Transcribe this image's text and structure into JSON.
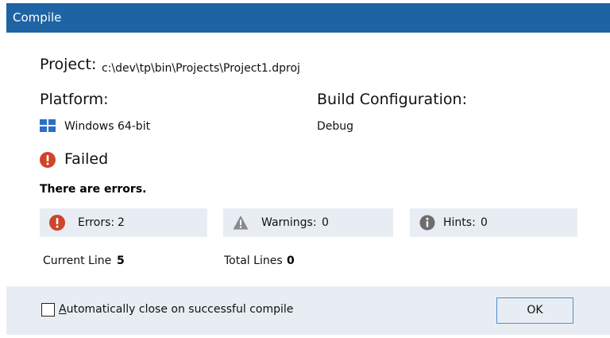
{
  "window": {
    "title": "Compile"
  },
  "project": {
    "label": "Project:",
    "path": "c:\\dev\\tp\\bin\\Projects\\Project1.dproj"
  },
  "platform": {
    "label": "Platform:",
    "value": "Windows 64-bit",
    "icon": "windows-logo-icon"
  },
  "build_configuration": {
    "label": "Build Configuration:",
    "value": "Debug"
  },
  "status": {
    "text": "Failed",
    "icon": "error-icon",
    "message": "There are errors."
  },
  "stats": {
    "errors": {
      "label": "Errors:",
      "value": "2",
      "icon": "error-icon"
    },
    "warnings": {
      "label": "Warnings:",
      "value": "0",
      "icon": "warning-icon"
    },
    "hints": {
      "label": "Hints:",
      "value": "0",
      "icon": "info-icon"
    }
  },
  "lines": {
    "current_label": "Current Line",
    "current_value": "5",
    "total_label": "Total Lines",
    "total_value": "0"
  },
  "footer": {
    "auto_close_mnemonic": "A",
    "auto_close_rest": "utomatically close on successful compile",
    "auto_close_checked": false,
    "ok_label": "OK"
  },
  "colors": {
    "title_bar": "#1e63a4",
    "panel_bg": "#e8edf3",
    "error_red": "#d0442b",
    "warning_gray": "#8a8a8a",
    "info_gray": "#6d6d6d",
    "windows_blue": "#2d6fc4",
    "ok_border": "#4f8fd1"
  }
}
